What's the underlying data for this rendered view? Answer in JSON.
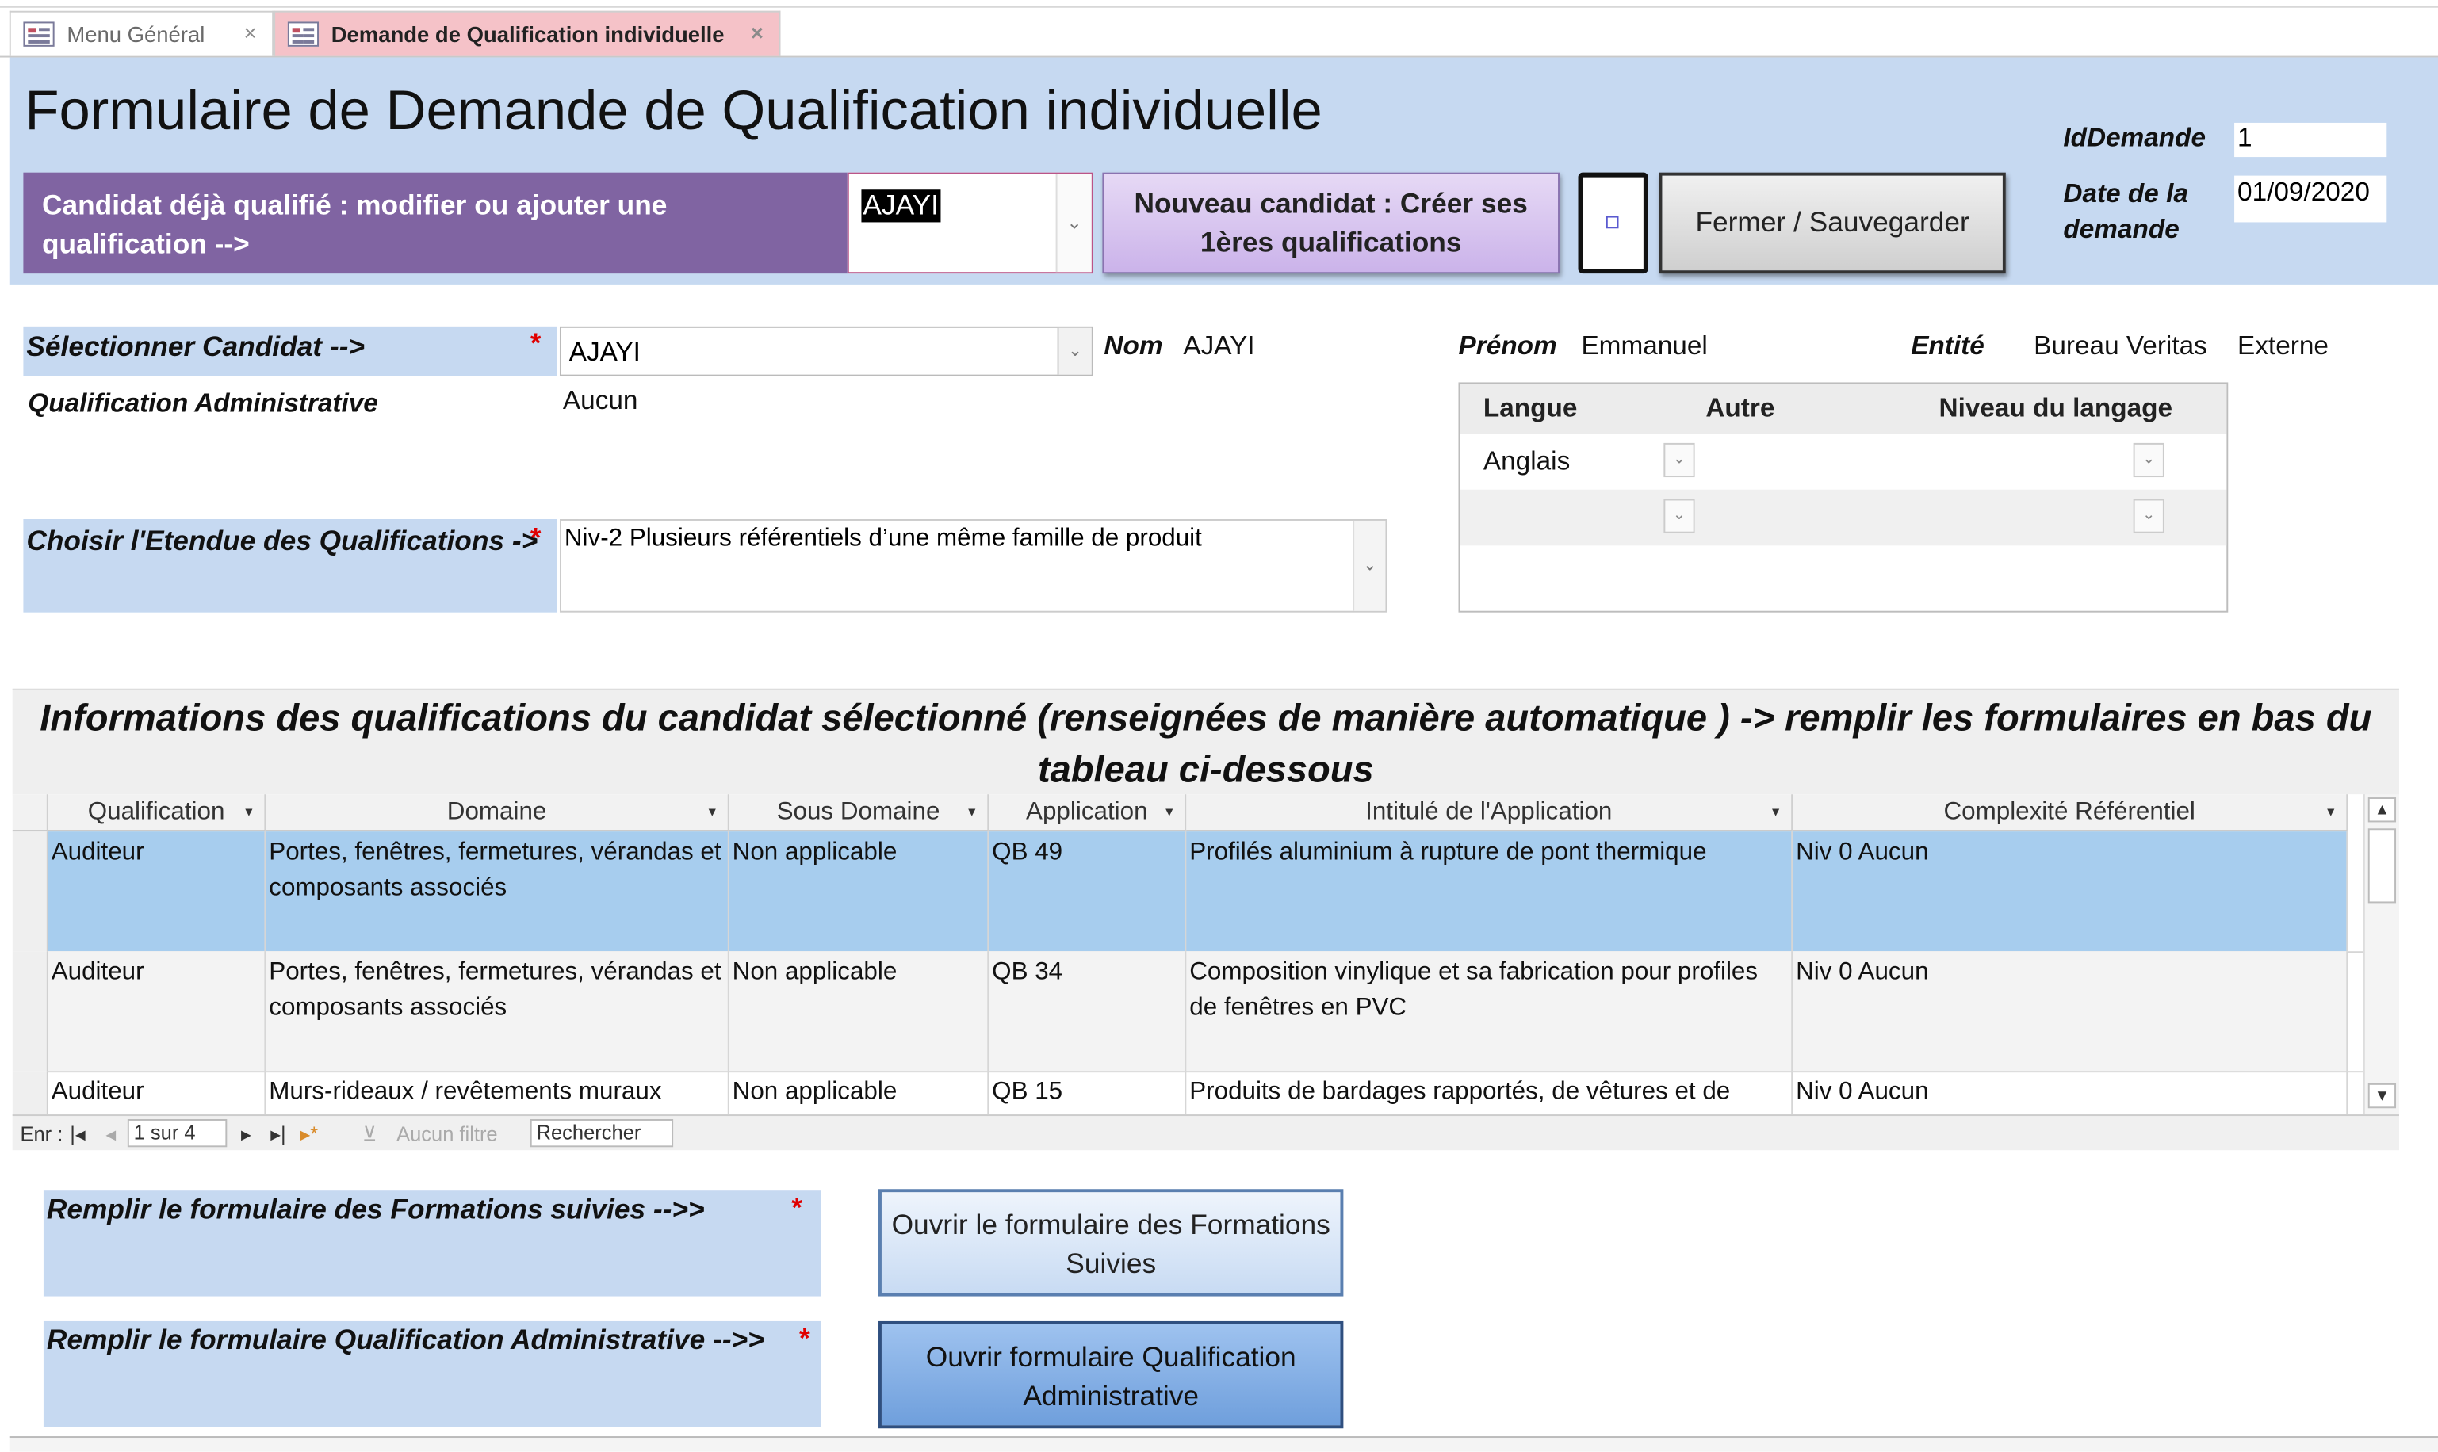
{
  "tabs": [
    {
      "label": "Menu Général",
      "close": "×",
      "active": false
    },
    {
      "label": "Demande de Qualification individuelle",
      "close": "×",
      "active": true
    }
  ],
  "header": {
    "title": "Formulaire de Demande de Qualification individuelle",
    "existing_candidate_label": "Candidat déjà qualifié : modifier ou ajouter une qualification -->",
    "existing_candidate_value": "AJAYI",
    "new_candidate_button": "Nouveau candidat : Créer ses 1ères qualifications",
    "close_save_button": "Fermer / Sauvegarder",
    "id_label": "IdDemande",
    "id_value": "1",
    "date_label": "Date de la demande",
    "date_value": "01/09/2020"
  },
  "candidate": {
    "select_label": "Sélectionner Candidat   -->",
    "required_mark": "*",
    "select_value": "AJAYI",
    "nom_label": "Nom",
    "nom_value": "AJAYI",
    "prenom_label": "Prénom",
    "prenom_value": "Emmanuel",
    "entite_label": "Entité",
    "entite_value": "Bureau Veritas",
    "entite_type": "Externe",
    "qual_admin_label": "Qualification Administrative",
    "qual_admin_value": "Aucun",
    "etendue_label": "Choisir l'Etendue des Qualifications ->",
    "etendue_value": "Niv-2 Plusieurs référentiels d’une même famille de produit"
  },
  "langue": {
    "headers": [
      "Langue",
      "Autre",
      "Niveau du langage"
    ],
    "rows": [
      {
        "langue": "Anglais",
        "autre": "",
        "niveau": ""
      },
      {
        "langue": "",
        "autre": "",
        "niveau": ""
      }
    ]
  },
  "info_heading": "Informations des qualifications du candidat sélectionné (renseignées de manière automatique ) -> remplir les formulaires en bas du tableau ci-dessous",
  "qualifications_table": {
    "columns": [
      "Qualification",
      "Domaine",
      "Sous Domaine",
      "Application",
      "Intitulé de l'Application",
      "Complexité Référentiel"
    ],
    "rows": [
      {
        "qualification": "Auditeur",
        "domaine": "Portes, fenêtres, fermetures, vérandas et composants associés",
        "sous_domaine": "Non applicable",
        "application": "QB 49",
        "intitule": "Profilés aluminium à rupture de pont thermique",
        "complexite": "Niv 0 Aucun"
      },
      {
        "qualification": "Auditeur",
        "domaine": "Portes, fenêtres, fermetures, vérandas et composants associés",
        "sous_domaine": "Non applicable",
        "application": "QB 34",
        "intitule": "Composition vinylique et sa fabrication pour profiles de fenêtres en PVC",
        "complexite": "Niv 0 Aucun"
      },
      {
        "qualification": "Auditeur",
        "domaine": "Murs-rideaux / revêtements muraux",
        "sous_domaine": "Non applicable",
        "application": "QB 15",
        "intitule": "Produits de bardages rapportés, de vêtures et de",
        "complexite": "Niv 0 Aucun"
      }
    ]
  },
  "record_nav": {
    "label": "Enr :",
    "position": "1 sur 4",
    "filter": "Aucun filtre",
    "search": "Rechercher"
  },
  "forms": {
    "formations_label": "Remplir le formulaire des  Formations suivies -->>",
    "formations_button": "Ouvrir le formulaire des Formations Suivies",
    "qual_admin_label": "Remplir le formulaire Qualification Administrative -->>",
    "qual_admin_button": "Ouvrir formulaire Qualification Administrative"
  },
  "colors": {
    "header_bg": "#c6d9f1",
    "purple": "#8064a2",
    "active_tab": "#f5c2c8",
    "selected_row": "#a7cdee",
    "required": "#e00000"
  }
}
